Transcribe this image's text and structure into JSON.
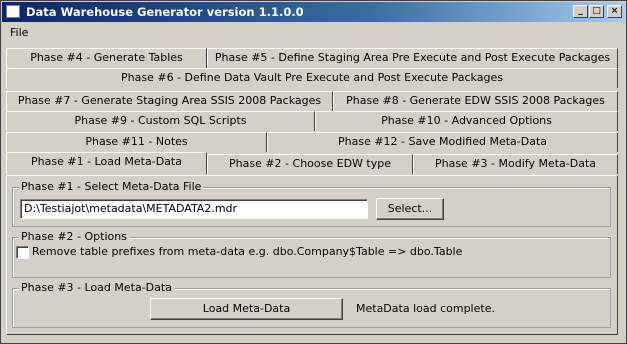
{
  "window": {
    "title": "Data Warehouse Generator version 1.1.0.0",
    "controls": {
      "minimize": "_",
      "maximize": "□",
      "close": "×"
    }
  },
  "menu": {
    "file": "File"
  },
  "tabs": {
    "row1": [
      "Phase #4 - Generate Tables",
      "Phase #5 - Define Staging Area Pre Execute and Post Execute Packages"
    ],
    "row2": [
      "Phase #6 - Define Data Vault Pre Execute and Post Execute Packages"
    ],
    "row3": [
      "Phase #7 - Generate Staging Area SSIS 2008 Packages",
      "Phase #8 - Generate EDW SSIS 2008 Packages"
    ],
    "row4": [
      "Phase #9 - Custom SQL Scripts",
      "Phase #10 - Advanced Options"
    ],
    "row5": [
      "Phase #11 - Notes",
      "Phase #12 - Save Modified Meta-Data"
    ],
    "row6": [
      "Phase #1 - Load Meta-Data",
      "Phase #2 - Choose EDW type",
      "Phase #3 - Modify Meta-Data"
    ],
    "active": "Phase #1 - Load Meta-Data"
  },
  "phase1": {
    "group_title": "Phase #1 - Select Meta-Data File",
    "file_path": "D:\\Testiajot\\metadata\\METADATA2.mdr",
    "select_button": "Select..."
  },
  "phase2": {
    "group_title": "Phase #2 - Options",
    "remove_prefix_label": "Remove table prefixes from meta-data e.g. dbo.Company$Table => dbo.Table",
    "remove_prefix_checked": false
  },
  "phase3": {
    "group_title": "Phase #3 - Load Meta-Data",
    "load_button": "Load Meta-Data",
    "status": "MetaData load complete."
  }
}
